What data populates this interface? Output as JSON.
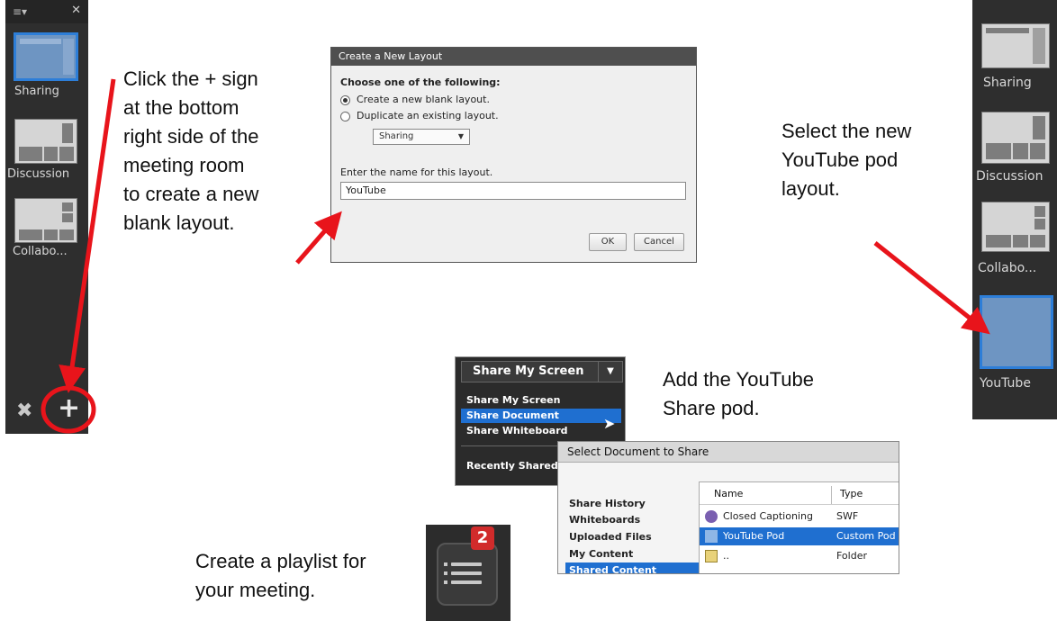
{
  "left_panel": {
    "layouts": [
      {
        "label": "Sharing",
        "selected": true
      },
      {
        "label": "Discussion",
        "selected": false
      },
      {
        "label": "Collabo...",
        "selected": false
      }
    ],
    "add_label": "+",
    "close_label": "✕",
    "menu_label": "≡▾",
    "wrench_label": "✖"
  },
  "right_panel": {
    "layouts": [
      {
        "label": "Sharing",
        "selected": false
      },
      {
        "label": "Discussion",
        "selected": false
      },
      {
        "label": "Collabo...",
        "selected": false
      },
      {
        "label": "YouTube",
        "selected": true
      }
    ]
  },
  "dialog": {
    "title": "Create a New Layout",
    "prompt": "Choose one of the following:",
    "option_new": "Create a new blank layout.",
    "option_duplicate": "Duplicate an existing layout.",
    "dropdown_value": "Sharing",
    "name_label": "Enter the name for this layout.",
    "name_value": "YouTube",
    "ok_label": "OK",
    "cancel_label": "Cancel"
  },
  "share_menu": {
    "header": "Share My Screen",
    "items": [
      "Share My Screen",
      "Share Document",
      "Share Whiteboard",
      "Recently Shared"
    ],
    "highlighted": "Share Document"
  },
  "doc_dialog": {
    "title": "Select Document to Share",
    "sidebar": [
      "Share History",
      "Whiteboards",
      "Uploaded Files",
      "My Content",
      "Shared Content"
    ],
    "sidebar_selected": "Shared Content",
    "columns": [
      "Name",
      "Type"
    ],
    "rows": [
      {
        "name": "Closed Captioning",
        "type": "SWF"
      },
      {
        "name": "YouTube Pod",
        "type": "Custom Pod"
      },
      {
        "name": "..",
        "type": "Folder"
      }
    ]
  },
  "playlist": {
    "badge": "2"
  },
  "instructions": {
    "step1": [
      "Click the + sign",
      "at the bottom",
      "right side of the",
      "meeting room",
      "to create a new",
      "blank layout."
    ],
    "step2": [
      "Select the new",
      "YouTube pod",
      "layout."
    ],
    "step3": [
      "Add the YouTube",
      "Share pod."
    ],
    "step4": [
      "Create a playlist for",
      "your meeting."
    ]
  },
  "colors": {
    "arrow": "#e8141b",
    "selection_blue": "#1f6fd0",
    "panel_bg": "#2e2e2e"
  }
}
